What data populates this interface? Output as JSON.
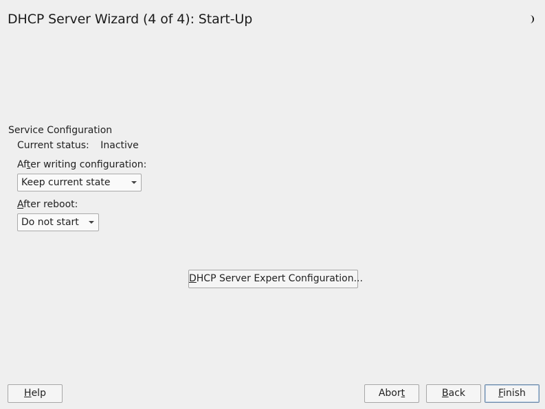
{
  "window": {
    "title": "DHCP Server Wizard (4 of 4): Start-Up"
  },
  "service": {
    "section_title": "Service Configuration",
    "status_label": "Current status:",
    "status_value": "Inactive",
    "after_write_label_pre": "Af",
    "after_write_label_key": "t",
    "after_write_label_post": "er writing configuration:",
    "after_write_value": "Keep current state",
    "after_reboot_label_key": "A",
    "after_reboot_label_post": "fter reboot:",
    "after_reboot_value": "Do not start"
  },
  "expert": {
    "label_key": "D",
    "label_post": "HCP Server Expert Configuration..."
  },
  "buttons": {
    "help_key": "H",
    "help_post": "elp",
    "abort_pre": "Abor",
    "abort_key": "t",
    "back_key": "B",
    "back_post": "ack",
    "finish_key": "F",
    "finish_post": "inish"
  },
  "icons": {
    "theme": "moon-icon"
  }
}
